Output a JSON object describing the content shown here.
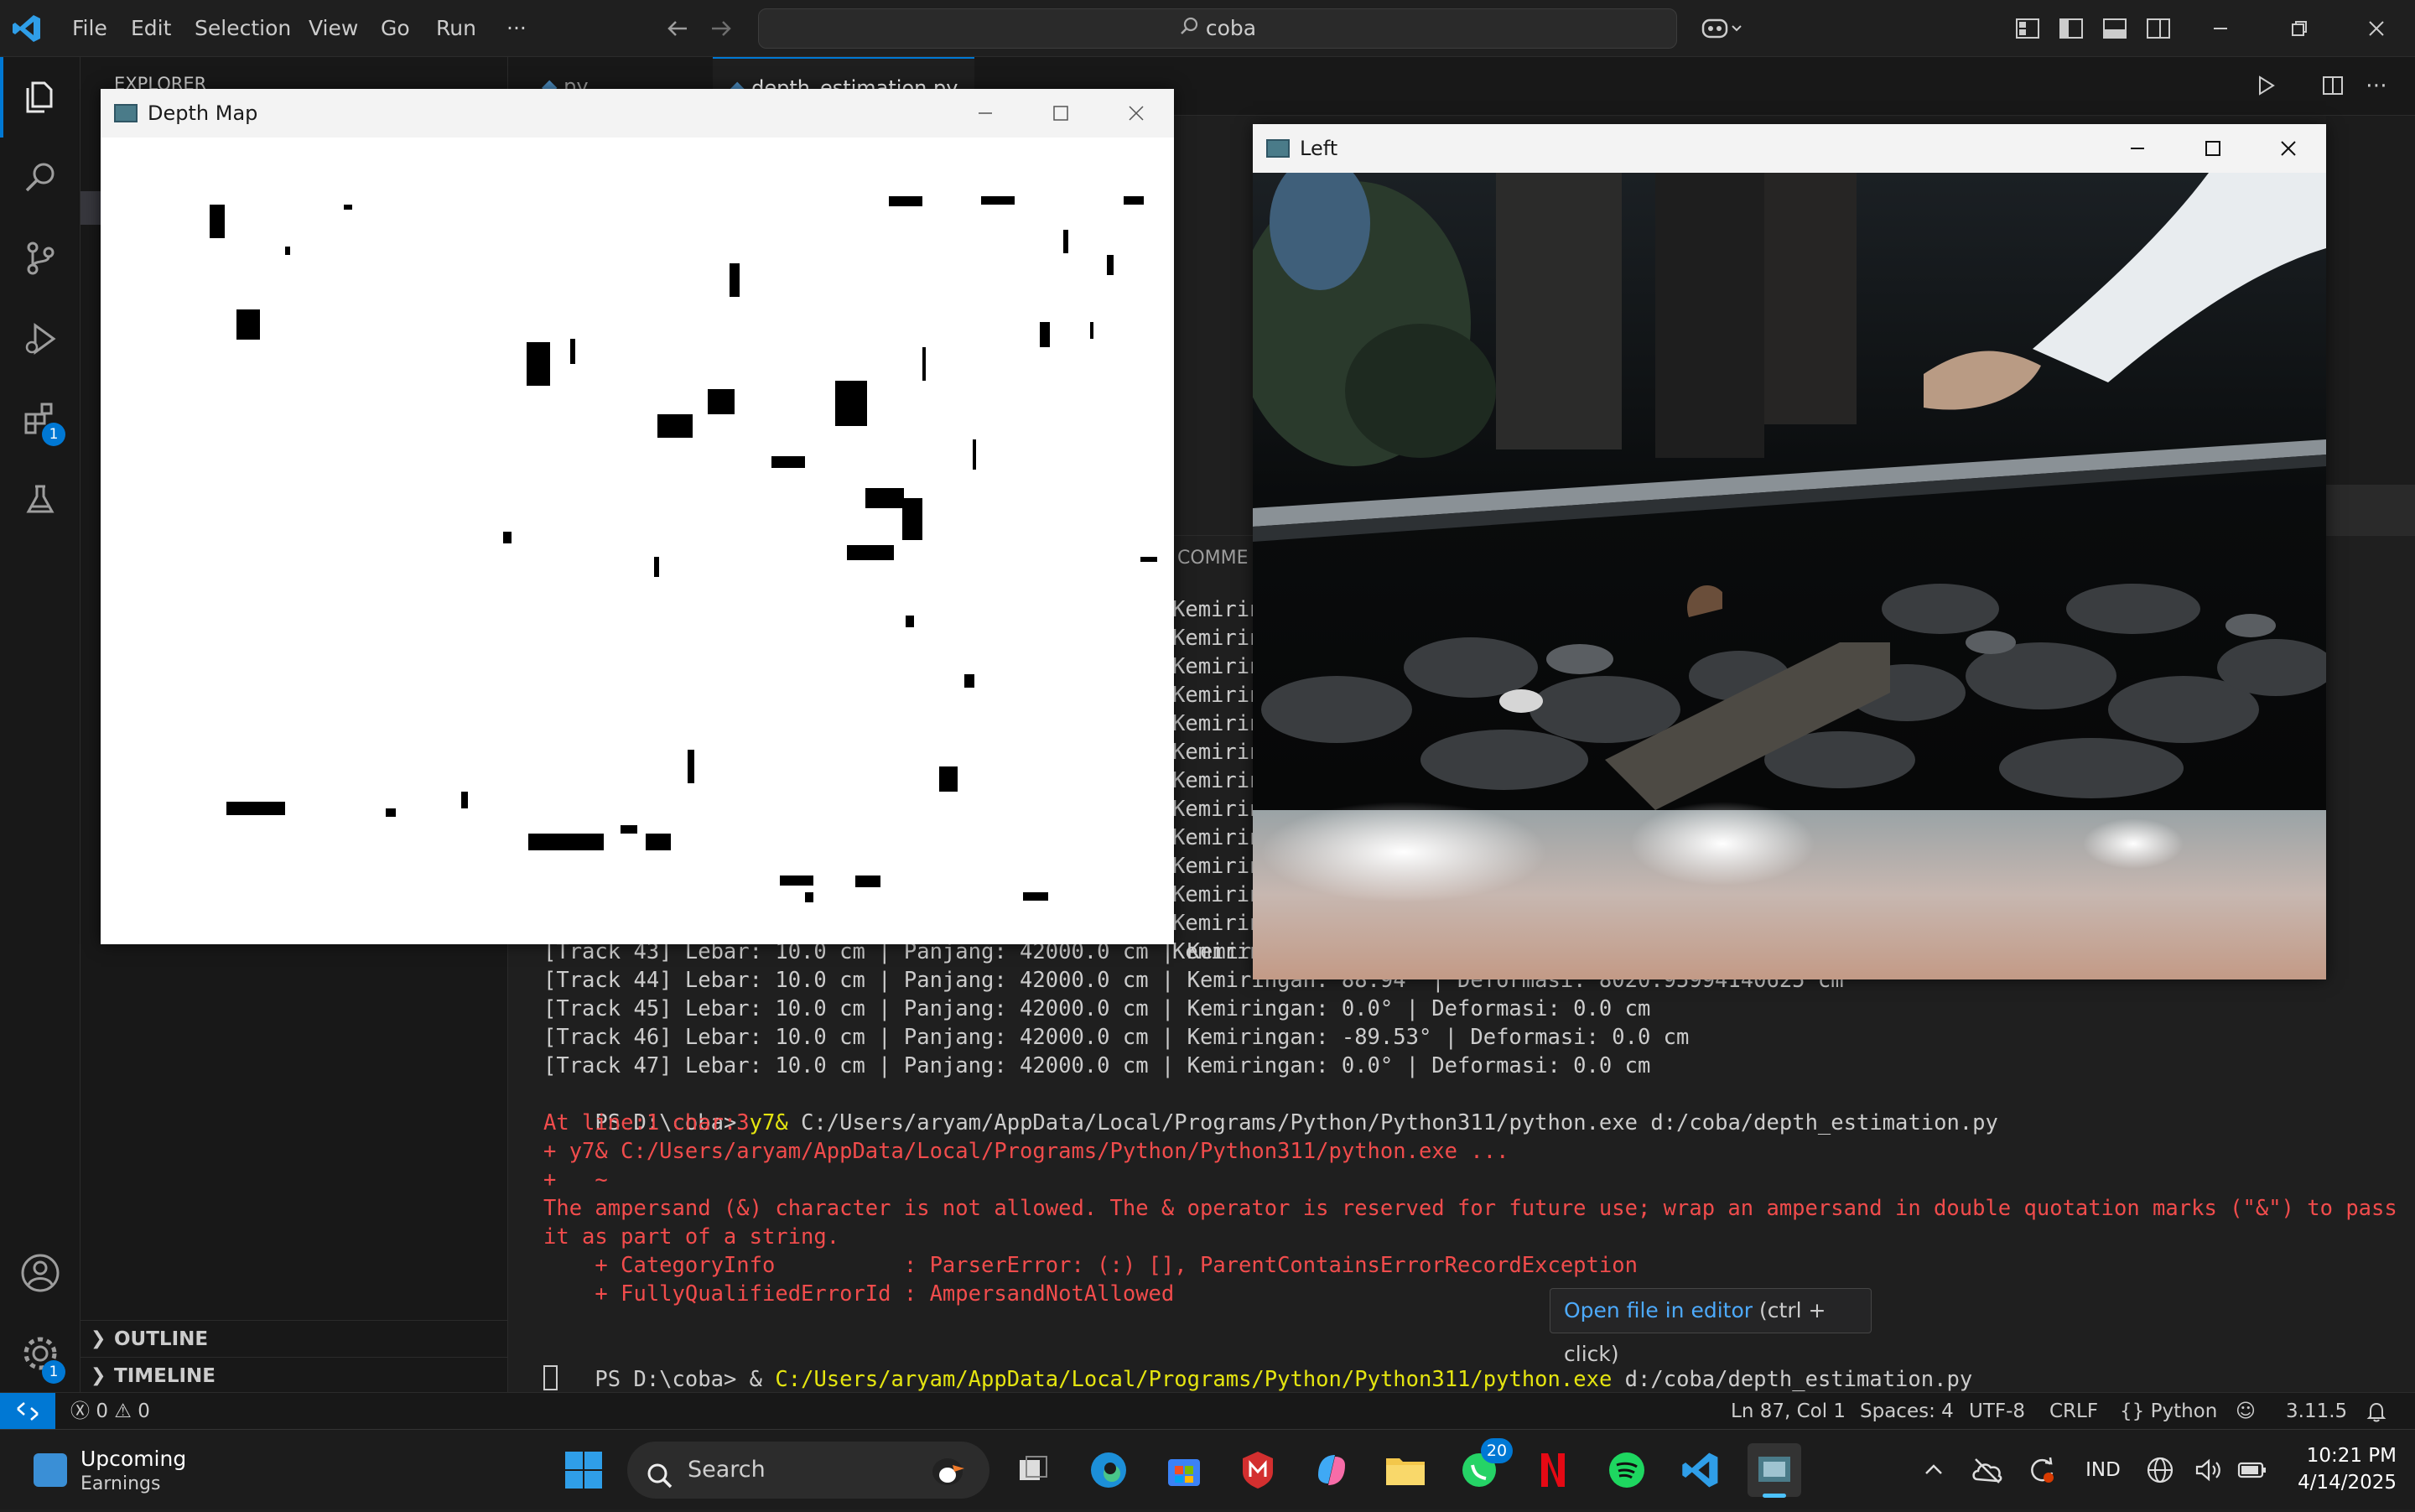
{
  "titlebar": {
    "menus": [
      "File",
      "Edit",
      "Selection",
      "View",
      "Go",
      "Run",
      "···"
    ],
    "search_text": "coba"
  },
  "activitybar": {
    "extensions_badge": "1",
    "settings_badge": "1"
  },
  "sidebar": {
    "header": "EXPLORER",
    "outline_label": "OUTLINE",
    "timeline_label": "TIMELINE"
  },
  "editor": {
    "tabs": [
      {
        "label": "py"
      },
      {
        "label": "depth_estimation.py"
      }
    ],
    "panel_tab": "COMME"
  },
  "terminal": {
    "prefix_lines": [
      "Kemirin",
      "Kemirin",
      "Kemirin",
      "Kemirin",
      "Kemirin",
      "Kemirin",
      "Kemirin",
      "Kemirin",
      "Kemirin",
      "Kemirin",
      "Kemirin",
      "Kemirin",
      "Kemirin"
    ],
    "track_lines": [
      "[Track 43] Lebar: 10.0 cm | Panjang: 42000.0 cm | Kemirin",
      "[Track 44] Lebar: 10.0 cm | Panjang: 42000.0 cm | Kemiringan: 88.94° | Deformasi: 8020.95994140625 cm",
      "[Track 45] Lebar: 10.0 cm | Panjang: 42000.0 cm | Kemiringan: 0.0° | Deformasi: 0.0 cm",
      "[Track 46] Lebar: 10.0 cm | Panjang: 42000.0 cm | Kemiringan: -89.53° | Deformasi: 0.0 cm",
      "[Track 47] Lebar: 10.0 cm | Panjang: 42000.0 cm | Kemiringan: 0.0° | Deformasi: 0.0 cm"
    ],
    "prompt1": "PS D:\\coba>",
    "cmd1_token": "y7&",
    "cmd1_rest": "C:/Users/aryam/AppData/Local/Programs/Python/Python311/python.exe d:/coba/depth_estimation.py",
    "error_lines": [
      "At line:1 char:3",
      "+ y7& C:/Users/aryam/AppData/Local/Programs/Python/Python311/python.exe ...",
      "+   ~",
      "The ampersand (&) character is not allowed. The & operator is reserved for future use; wrap an ampersand in double quotation marks (\"&\") to pass",
      "it as part of a string.",
      "    + CategoryInfo          : ParserError: (:) [], ParentContainsErrorRecordException",
      "    + FullyQualifiedErrorId : AmpersandNotAllowed"
    ],
    "prompt2": "PS D:\\coba>",
    "cmd2_amp": "&",
    "cmd2_exe": "C:/Users/aryam/AppData/Local/Programs/Python/Python311/python.exe",
    "cmd2_arg": "d:/coba/depth_estimation.py",
    "hover_link": "Open file in editor",
    "hover_hint": "(ctrl + click)"
  },
  "statusbar": {
    "errors": "0",
    "warnings": "0",
    "position": "Ln 87, Col 1",
    "spaces": "Spaces: 4",
    "encoding": "UTF-8",
    "eol": "CRLF",
    "language": "Python",
    "version": "3.11.5"
  },
  "windows": {
    "depth": {
      "title": "Depth Map"
    },
    "left": {
      "title": "Left"
    }
  },
  "taskbar": {
    "weather_title": "Upcoming",
    "weather_sub": "Earnings",
    "search_label": "Search",
    "whatsapp_badge": "20",
    "lang": "IND",
    "time": "10:21 PM",
    "date": "4/14/2025"
  }
}
